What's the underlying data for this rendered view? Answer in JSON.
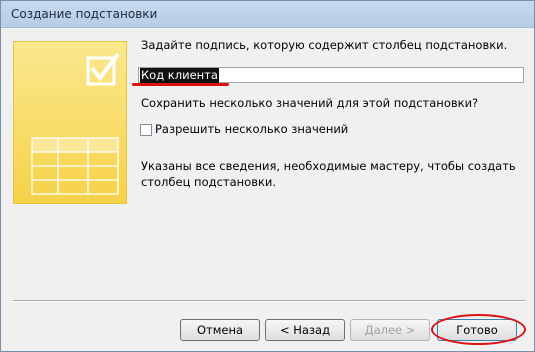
{
  "window": {
    "title": "Создание подстановки"
  },
  "main": {
    "prompt": "Задайте подпись, которую содержит столбец подстановки.",
    "label_value": "Код клиента",
    "question": "Сохранить несколько значений для этой подстановки?",
    "checkbox_label": "Разрешить несколько значений",
    "checkbox_checked": false,
    "info": "Указаны все сведения, необходимые мастеру, чтобы создать столбец подстановки."
  },
  "buttons": {
    "cancel": "Отмена",
    "back": "< Назад",
    "next": "Далее >",
    "finish": "Готово"
  },
  "colors": {
    "highlight": "#dd1111",
    "panel": "#f6d24a"
  }
}
